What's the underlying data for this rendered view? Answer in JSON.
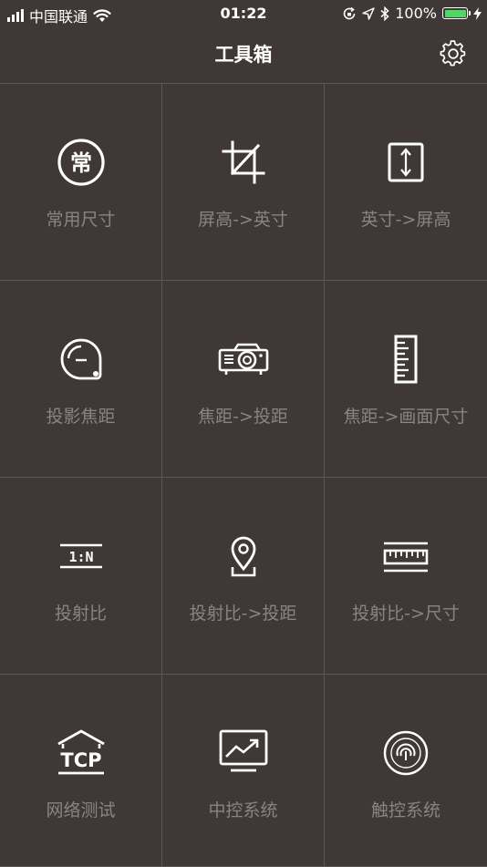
{
  "status_bar": {
    "carrier": "中国联通",
    "time": "01:22",
    "battery_percent": "100%",
    "battery_color": "#4cd964"
  },
  "nav": {
    "title": "工具箱",
    "settings_icon": "gear-icon"
  },
  "tools": [
    {
      "label": "常用尺寸",
      "icon": "chang-badge-icon"
    },
    {
      "label": "屏高->英寸",
      "icon": "crop-icon"
    },
    {
      "label": "英寸->屏高",
      "icon": "vertical-arrows-icon"
    },
    {
      "label": "投影焦距",
      "icon": "tape-measure-icon"
    },
    {
      "label": "焦距->投距",
      "icon": "projector-icon"
    },
    {
      "label": "焦距->画面尺寸",
      "icon": "ruler-icon"
    },
    {
      "label": "投射比",
      "icon": "ratio-icon"
    },
    {
      "label": "投射比->投距",
      "icon": "location-pin-icon"
    },
    {
      "label": "投射比->尺寸",
      "icon": "horizontal-ruler-icon"
    },
    {
      "label": "网络测试",
      "icon": "tcp-house-icon"
    },
    {
      "label": "中控系统",
      "icon": "monitor-chart-icon"
    },
    {
      "label": "触控系统",
      "icon": "fingerprint-icon"
    }
  ],
  "icon_text": {
    "chang": "常",
    "ratio": "1:N",
    "tcp": "TCP"
  },
  "colors": {
    "background": "#403836",
    "divider": "#5e5654",
    "label": "#8a8381",
    "icon": "#ffffff"
  }
}
